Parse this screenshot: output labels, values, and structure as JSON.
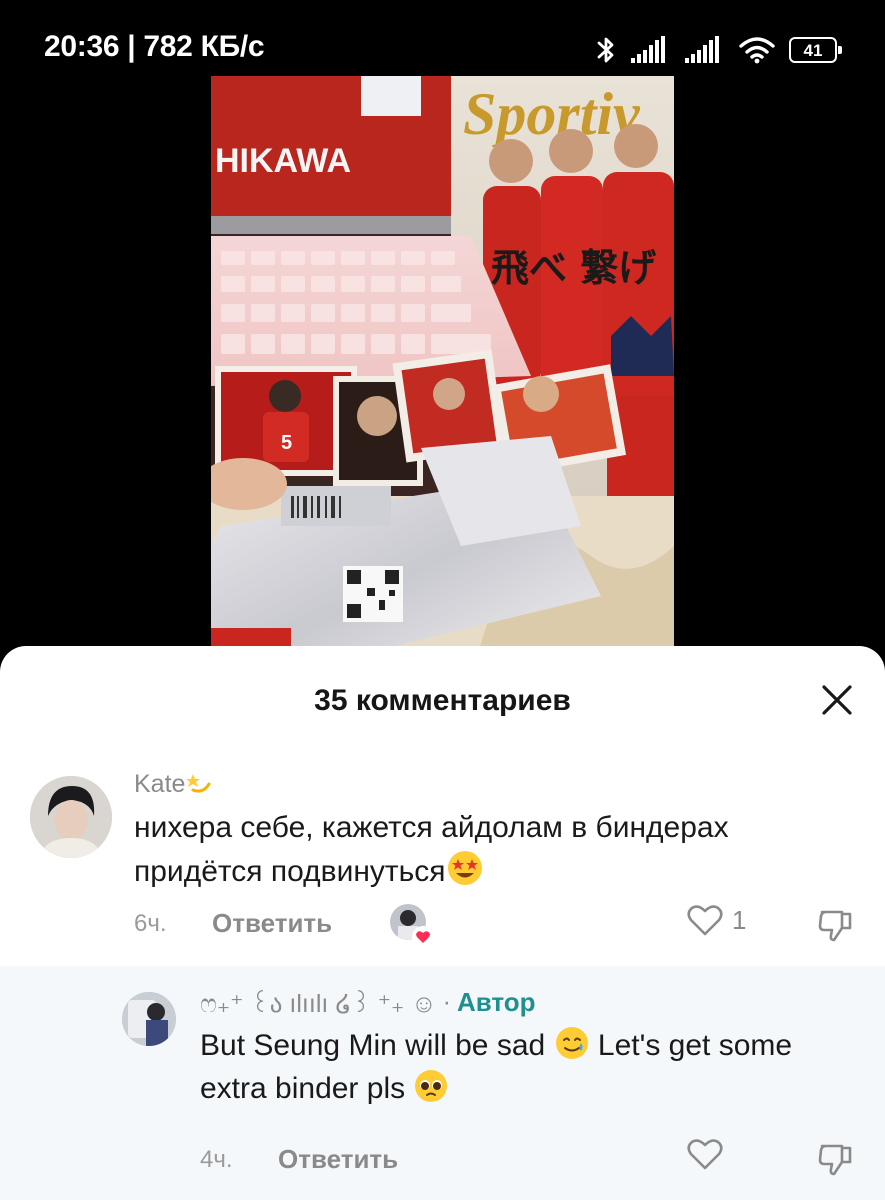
{
  "status_bar": {
    "time_speed": "20:36 | 782 КБ/с",
    "battery": "41",
    "icons": [
      "bluetooth-icon",
      "signal-icon",
      "signal-icon",
      "wifi-icon",
      "battery-icon"
    ]
  },
  "video": {
    "jersey_text": "HIKAWA",
    "magazine_title": "Sportiv",
    "magazine_kanji": "飛べ 繋げ",
    "card_number": "5"
  },
  "comments_sheet": {
    "title": "35 комментариев",
    "close_icon": "close-icon",
    "comments": [
      {
        "username": "Kate",
        "username_emoji": "dizzy-emoji",
        "text": "нихера себе, кажется айдолам в биндерах придётся подвинуться",
        "text_emoji": "star-struck-emoji",
        "time": "6ч.",
        "reply_label": "Ответить",
        "creator_liked": true,
        "like_count": "1"
      },
      {
        "username": "ෆ₊⁺ ꒰ა ılıılı ໒꒱ ⁺₊ ☺",
        "author_tag": "Автор",
        "text_part1": "But Seung Min will be sad",
        "text_part2": "Let's get some extra binder pls",
        "time": "4ч.",
        "reply_label": "Ответить",
        "like_count": ""
      }
    ]
  },
  "colors": {
    "author_tag": "#1f8f8f",
    "reply_background": "#f4f8fa",
    "heart_badge": "#fe2c55"
  }
}
